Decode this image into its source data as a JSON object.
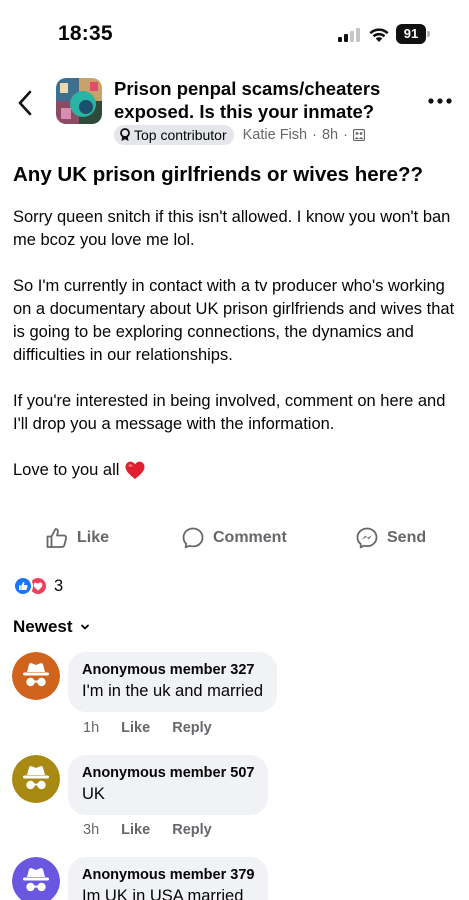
{
  "status_bar": {
    "time": "18:35",
    "battery": "91"
  },
  "header": {
    "group_name": "Prison penpal scams/cheaters exposed. Is this your inmate?",
    "badge": "Top contributor",
    "author": "Katie Fish",
    "time": "8h",
    "icons": [
      "back-arrow-icon",
      "more-options-icon",
      "group-icon",
      "badge-icon"
    ]
  },
  "post": {
    "title": "Any UK prison girlfriends or wives here??",
    "paragraphs": [
      "Sorry queen snitch if this isn't allowed. I know you won't ban me bcoz you love me lol.",
      "So I'm currently in contact with a tv producer who's working on a documentary about UK prison girlfriends and wives that is going to be exploring connections, the dynamics and difficulties in our relationships.",
      "If you're interested in being involved, comment on here and I'll drop you a message with the information.",
      "Love to you all"
    ]
  },
  "actions": {
    "like": "Like",
    "comment": "Comment",
    "send": "Send"
  },
  "reactions": {
    "count": "3",
    "types": [
      "like",
      "love"
    ]
  },
  "sort": {
    "label": "Newest"
  },
  "comments": [
    {
      "author": "Anonymous member 327",
      "text": "I'm in the uk and married",
      "time": "1h",
      "like": "Like",
      "reply": "Reply",
      "avatar_color": "#d0641d"
    },
    {
      "author": "Anonymous member 507",
      "text": "UK",
      "time": "3h",
      "like": "Like",
      "reply": "Reply",
      "avatar_color": "#a88a12"
    },
    {
      "author": "Anonymous member 379",
      "text": "Im UK in USA married",
      "avatar_color": "#6a57e0"
    }
  ],
  "colors": {
    "accent": "#1877f2",
    "love": "#f33e58",
    "secondary_text": "#65676b",
    "bubble": "#f0f2f5"
  }
}
